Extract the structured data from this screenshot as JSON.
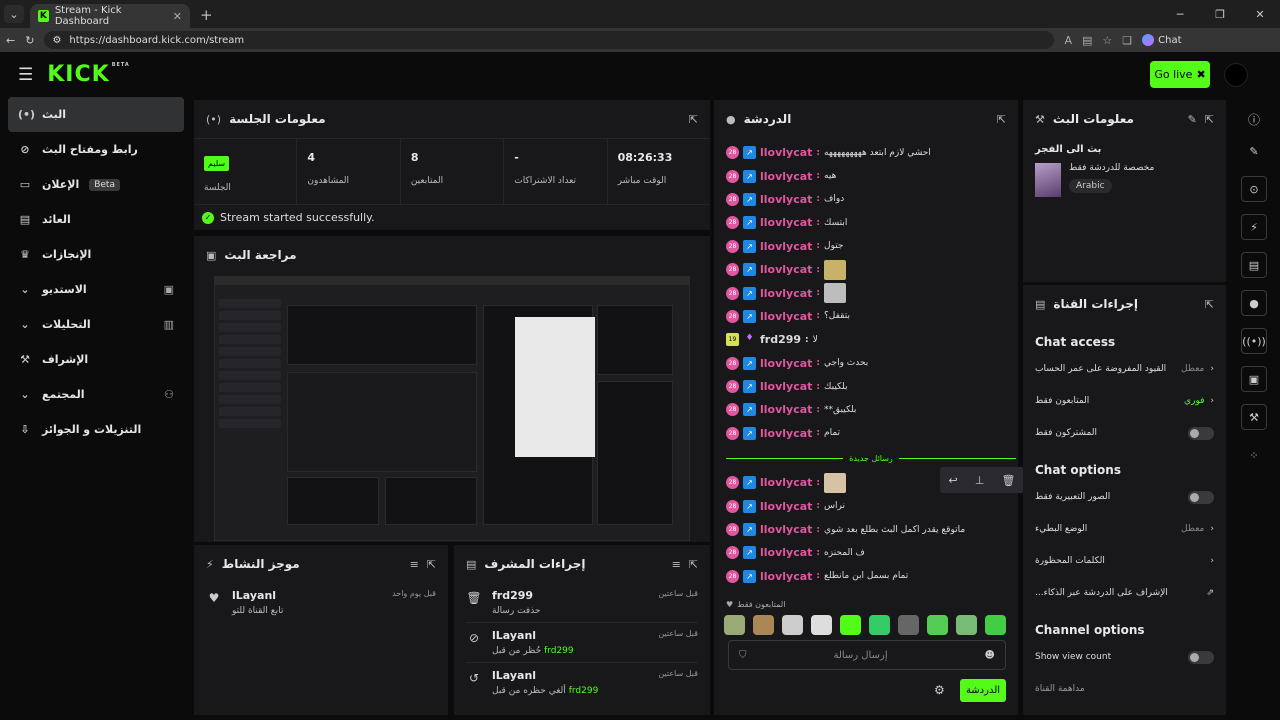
{
  "browser": {
    "tab_title": "Stream - Kick Dashboard",
    "url": "https://dashboard.kick.com/stream",
    "chat_label": "Chat"
  },
  "topbar": {
    "logo": "KICK",
    "logo_sup": "BETA",
    "golive": "Go live"
  },
  "sidebar": {
    "items": [
      {
        "label": "البث",
        "icon": "broadcast-icon"
      },
      {
        "label": "رابط ومفتاح البث",
        "icon": "link-icon"
      },
      {
        "label": "الإعلان",
        "badge": "Beta",
        "icon": "ad-icon"
      },
      {
        "label": "العائد",
        "icon": "revenue-icon"
      },
      {
        "label": "الإنجازات",
        "icon": "trophy-icon"
      },
      {
        "label": "الاستديو",
        "icon": "studio-icon"
      },
      {
        "label": "التحليلات",
        "icon": "analytics-icon"
      },
      {
        "label": "الإشراف",
        "icon": "hammer-icon"
      },
      {
        "label": "المجتمع",
        "icon": "community-icon"
      },
      {
        "label": "التنزيلات و الجوائز",
        "icon": "drops-icon"
      }
    ]
  },
  "session": {
    "title": "معلومات الجلسة",
    "stats": [
      {
        "value": "08:26:33",
        "label": "الوقت مباشر"
      },
      {
        "value": "-",
        "label": "تعداد الاشتراكات"
      },
      {
        "value": "8",
        "label": "المتابعين"
      },
      {
        "value": "4",
        "label": "المشاهدون"
      },
      {
        "value": "سليم",
        "label": "الجلسة"
      }
    ],
    "toast": "Stream started successfully."
  },
  "preview": {
    "title": "مراجعة البث"
  },
  "activity": {
    "title": "موجز النشاط",
    "items": [
      {
        "name": "lLayanl",
        "sub": "تابع القناة للتو",
        "time": "قبل يوم واحد"
      }
    ]
  },
  "modactions": {
    "title": "إجراءات المشرف",
    "items": [
      {
        "name": "frd299",
        "sub": "حذفت رسالة",
        "time": "قبل ساعتين",
        "icon": "trash-icon"
      },
      {
        "name": "lLayanl",
        "sub": "حُظر من قبل",
        "who": "frd299",
        "time": "قبل ساعتين",
        "icon": "ban-icon"
      },
      {
        "name": "lLayanl",
        "sub": "ألغي حظره من قبل",
        "who": "frd299",
        "time": "قبل ساعتين",
        "icon": "undo-icon"
      }
    ]
  },
  "chat": {
    "title": "الدردشة",
    "messages": [
      {
        "user": "llovlycat",
        "text": "احشي لازم ابتعد هههههههههه",
        "badge": "28"
      },
      {
        "user": "llovlycat",
        "text": "هيه",
        "badge": "28"
      },
      {
        "user": "llovlycat",
        "text": "دواف",
        "badge": "28"
      },
      {
        "user": "llovlycat",
        "text": "ابتسك",
        "badge": "28"
      },
      {
        "user": "llovlycat",
        "text": "جتول",
        "badge": "28"
      },
      {
        "user": "llovlycat",
        "text": "",
        "badge": "28",
        "emote": "#c8b26a"
      },
      {
        "user": "llovlycat",
        "text": "",
        "badge": "28",
        "emote": "#bdbdbd"
      },
      {
        "user": "llovlycat",
        "text": "بتقفل؟",
        "badge": "28"
      },
      {
        "user": "frd299",
        "text": "لا",
        "badge": "19",
        "mod": true
      },
      {
        "user": "llovlycat",
        "text": "بحدث واجي",
        "badge": "28"
      },
      {
        "user": "llovlycat",
        "text": "بلكيبك",
        "badge": "28"
      },
      {
        "user": "llovlycat",
        "text": "**بلكيبق",
        "badge": "28"
      },
      {
        "user": "llovlycat",
        "text": "تمام",
        "badge": "28"
      }
    ],
    "divider": "رسائل جديدة",
    "new_messages": [
      {
        "user": "llovlycat",
        "text": "",
        "badge": "28",
        "emote": "#d8c2a6"
      },
      {
        "user": "llovlycat",
        "text": "نراس",
        "badge": "28"
      },
      {
        "user": "llovlycat",
        "text": "ماتوقع يقدر اكمل البث بطلع بعد شوي",
        "badge": "28"
      },
      {
        "user": "llovlycat",
        "text": "ف المحنزه",
        "badge": "28"
      },
      {
        "user": "llovlycat",
        "text": "تمام بسمل ابن مانطلع",
        "badge": "28"
      }
    ],
    "followers_only": "المتابعون فقط",
    "placeholder": "إرسال رسالة",
    "send": "الدردشة",
    "emote_colors": [
      "#9a7",
      "#a85",
      "#ccc",
      "#ddd",
      "#53fc18",
      "#3c6",
      "#666",
      "#5c5",
      "#7b7",
      "#4c4"
    ]
  },
  "streaminfo": {
    "title": "معلومات البث",
    "stream_title": "بث الى الفجر",
    "category": "مخصصة للدردشة فقط",
    "language": "Arabic"
  },
  "channel": {
    "title": "إجراءات القناة",
    "chat_access": "Chat access",
    "access_rows": [
      {
        "label": "القيود المفروضة على عمر الحساب",
        "value": "معطل",
        "type": "arrow"
      },
      {
        "label": "المتابعون فقط",
        "value": "فوري",
        "type": "arrow",
        "green": true
      },
      {
        "label": "المشتركون فقط",
        "type": "toggle"
      }
    ],
    "chat_options": "Chat options",
    "option_rows": [
      {
        "label": "الصور التعبيرية فقط",
        "type": "toggle"
      },
      {
        "label": "الوضع البطيء",
        "value": "معطل",
        "type": "arrow"
      },
      {
        "label": "الكلمات المحظورة",
        "type": "arrow"
      },
      {
        "label": "...الإشراف على الدردشة عبر الذكاء",
        "type": "link"
      }
    ],
    "channel_options": "Channel options",
    "channel_rows": [
      {
        "label": "Show view count",
        "type": "toggle"
      }
    ],
    "footer": "مداهمة القناة"
  },
  "rail": {
    "icons": [
      "info-icon",
      "edit-icon",
      "camera-icon",
      "bolt-icon",
      "doc-icon",
      "chat-bubble-icon",
      "signal-icon",
      "screen-icon",
      "wrench-icon",
      "nodes-icon"
    ]
  }
}
